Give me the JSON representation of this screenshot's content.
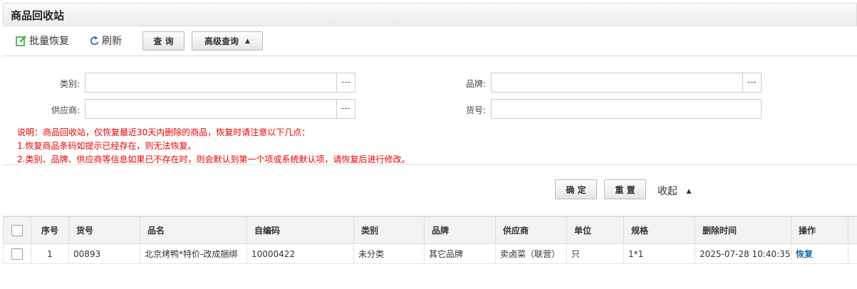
{
  "title": "商品回收站",
  "toolbar": {
    "batch_restore": "批量恢复",
    "refresh": "刷新",
    "query": "查 询",
    "advanced_query": "高级查询"
  },
  "filters": {
    "category_label": "类别:",
    "brand_label": "品牌:",
    "supplier_label": "供应商:",
    "item_no_label": "货号:",
    "category_value": "",
    "brand_value": "",
    "supplier_value": "",
    "item_no_value": "",
    "picker": "---"
  },
  "notes": [
    "说明：商品回收站，仅恢复最近30天内删除的商品，恢复时请注意以下几点：",
    "1.恢复商品条码如提示已经存在，则无法恢复。",
    "2.类别、品牌、供应商等信息如果已不存在时，则会默认到第一个项或系统默认项，请恢复后进行修改。"
  ],
  "actions": {
    "confirm": "确 定",
    "reset": "重 置",
    "collapse": "收起"
  },
  "table": {
    "columns": [
      "序号",
      "货号",
      "品名",
      "自编码",
      "类别",
      "品牌",
      "供应商",
      "单位",
      "规格",
      "删除时间",
      "操作"
    ],
    "rows": [
      {
        "index": "1",
        "item_no": "00893",
        "name": "北京烤鸭*特价-改成捆绑",
        "code": "10000422",
        "category": "未分类",
        "brand": "其它品牌",
        "supplier": "卖卤菜（联营）",
        "unit": "只",
        "spec": "1*1",
        "deleted_at": "2025-07-28 10:40:35",
        "action": "恢复"
      }
    ]
  },
  "colors": {
    "note": "#e00000",
    "link": "#1f6fb2",
    "edit_icon": "#3aa53a",
    "refresh_icon": "#2d6db5"
  }
}
